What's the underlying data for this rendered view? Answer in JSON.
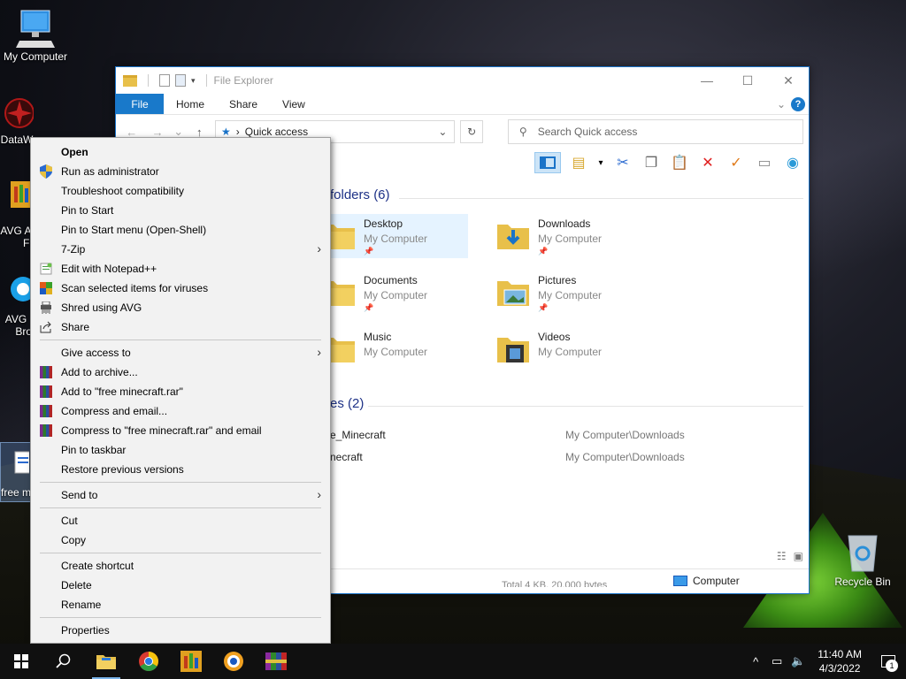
{
  "desktop": {
    "icons": [
      {
        "label": "My Computer"
      },
      {
        "label": "DataW"
      },
      {
        "label": "AVG A"
      },
      {
        "label": "Fi"
      },
      {
        "label": "AVG"
      },
      {
        "label": "Bro"
      },
      {
        "label": "free m"
      },
      {
        "label": "Recycle Bin"
      }
    ]
  },
  "explorer": {
    "title": "File Explorer",
    "tabs": [
      "File",
      "Home",
      "Share",
      "View"
    ],
    "address": "Quick access",
    "search_placeholder": "Search Quick access",
    "frequent_header": "folders (6)",
    "recent_header": "es (2)",
    "folders": [
      {
        "name": "Desktop",
        "location": "My Computer"
      },
      {
        "name": "Downloads",
        "location": "My Computer"
      },
      {
        "name": "Documents",
        "location": "My Computer"
      },
      {
        "name": "Pictures",
        "location": "My Computer"
      },
      {
        "name": "Music",
        "location": "My Computer"
      },
      {
        "name": "Videos",
        "location": "My Computer"
      }
    ],
    "recent": [
      {
        "name": "e_Minecraft",
        "path": "My Computer\\Downloads"
      },
      {
        "name": "necraft",
        "path": "My Computer\\Downloads"
      }
    ],
    "status_partial": "Total 4 KB, 20,000 bytes",
    "status_location": "Computer"
  },
  "context_menu": {
    "items": [
      {
        "label": "Open"
      },
      {
        "label": "Run as administrator"
      },
      {
        "label": "Troubleshoot compatibility"
      },
      {
        "label": "Pin to Start"
      },
      {
        "label": "Pin to Start menu (Open-Shell)"
      },
      {
        "label": "7-Zip"
      },
      {
        "label": "Edit with Notepad++"
      },
      {
        "label": "Scan selected items for viruses"
      },
      {
        "label": "Shred using AVG"
      },
      {
        "label": "Share"
      },
      {
        "label": "Give access to"
      },
      {
        "label": "Add to archive..."
      },
      {
        "label": "Add to \"free minecraft.rar\""
      },
      {
        "label": "Compress and email..."
      },
      {
        "label": "Compress to \"free minecraft.rar\" and email"
      },
      {
        "label": "Pin to taskbar"
      },
      {
        "label": "Restore previous versions"
      },
      {
        "label": "Send to"
      },
      {
        "label": "Cut"
      },
      {
        "label": "Copy"
      },
      {
        "label": "Create shortcut"
      },
      {
        "label": "Delete"
      },
      {
        "label": "Rename"
      },
      {
        "label": "Properties"
      }
    ]
  },
  "taskbar": {
    "time": "11:40 AM",
    "date": "4/3/2022",
    "notification_count": "1"
  },
  "colors": {
    "accent": "#1979ca",
    "taskbar": "#101010",
    "menu_bg": "#f2f2f2"
  }
}
